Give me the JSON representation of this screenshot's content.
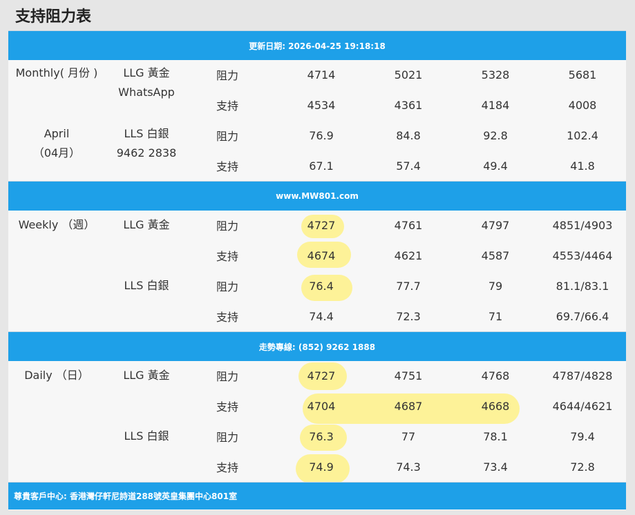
{
  "page": {
    "title": "支持阻力表"
  },
  "banners": {
    "update": "更新日期: 2026-04-25 19:18:18",
    "website": "www.MW801.com",
    "hotline": "走勢專線: (852) 9262 1888",
    "address": "尊貴客戶中心: 香港灣仔軒尼詩道288號英皇集團中心801室"
  },
  "monthly": {
    "period_line1": "Monthly( 月份 )",
    "period_line2": "April",
    "period_line3": "（04月）",
    "llg_label": "LLG 黃金",
    "llg_sub": "WhatsApp",
    "lls_label": "LLS 白銀",
    "lls_sub": "9462 2838",
    "rows": [
      {
        "type": "阻力",
        "values": [
          "4714",
          "5021",
          "5328",
          "5681"
        ]
      },
      {
        "type": "支持",
        "values": [
          "4534",
          "4361",
          "4184",
          "4008"
        ]
      },
      {
        "type": "阻力",
        "values": [
          "76.9",
          "84.8",
          "92.8",
          "102.4"
        ]
      },
      {
        "type": "支持",
        "values": [
          "67.1",
          "57.4",
          "49.4",
          "41.8"
        ]
      }
    ]
  },
  "weekly": {
    "period": "Weekly （週）",
    "llg_label": "LLG 黃金",
    "lls_label": "LLS 白銀",
    "rows": [
      {
        "type": "阻力",
        "values": [
          "4727",
          "4761",
          "4797",
          "4851/4903"
        ]
      },
      {
        "type": "支持",
        "values": [
          "4674",
          "4621",
          "4587",
          "4553/4464"
        ]
      },
      {
        "type": "阻力",
        "values": [
          "76.4",
          "77.7",
          "79",
          "81.1/83.1"
        ]
      },
      {
        "type": "支持",
        "values": [
          "74.4",
          "72.3",
          "71",
          "69.7/66.4"
        ]
      }
    ]
  },
  "daily": {
    "period": "Daily （日）",
    "llg_label": "LLG 黃金",
    "lls_label": "LLS 白銀",
    "rows": [
      {
        "type": "阻力",
        "values": [
          "4727",
          "4751",
          "4768",
          "4787/4828"
        ]
      },
      {
        "type": "支持",
        "values": [
          "4704",
          "4687",
          "4668",
          "4644/4621"
        ]
      },
      {
        "type": "阻力",
        "values": [
          "76.3",
          "77",
          "78.1",
          "79.4"
        ]
      },
      {
        "type": "支持",
        "values": [
          "74.9",
          "74.3",
          "73.4",
          "72.8"
        ]
      }
    ]
  },
  "colors": {
    "banner": "#1ea0e8",
    "highlight": "#fff078",
    "background": "#f7f7f7"
  }
}
